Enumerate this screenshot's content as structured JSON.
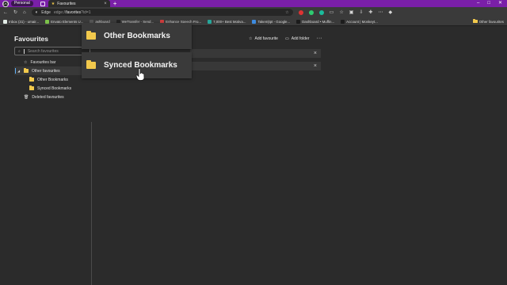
{
  "browser": {
    "profile_initials": "LK3",
    "profile_label": "Personal",
    "tab_title": "Favourites",
    "new_tab_glyph": "+",
    "url_prefix": "Edge",
    "url_host": "edge://",
    "url_path": "favorites",
    "url_suffix": "?id=1",
    "window_controls": [
      "–",
      "□",
      "✕"
    ],
    "accent_color": "#7a1fa8"
  },
  "bookmarks_bar": {
    "items": [
      {
        "label": "Inbox (31) - umair...",
        "color": "#e2ece6"
      },
      {
        "label": "Envato Elements U...",
        "color": "#7cc24a"
      },
      {
        "label": "ashboard",
        "color": "#555555"
      },
      {
        "label": "WeTransfer - Send...",
        "color": "#222222"
      },
      {
        "label": "Enhance Speech Fro...",
        "color": "#cc3d3d"
      },
      {
        "label": "7,000+ Best Motiva...",
        "color": "#26a69a"
      },
      {
        "label": "Takem|tpt - Google...",
        "color": "#3d8be0"
      },
      {
        "label": "Dashboard • Muffin...",
        "color": "#1b1b1b"
      },
      {
        "label": "Account | Monkeyt...",
        "color": "#1c1c1c"
      }
    ],
    "other_favourites": "Other favourites"
  },
  "sidebar": {
    "title": "Favourites",
    "search_placeholder": "Search favourites",
    "tree": [
      {
        "label": "Favourites bar",
        "icon": "star-icon",
        "depth": 0
      },
      {
        "label": "Other favourites",
        "icon": "folder-icon",
        "depth": 0,
        "expanded": true,
        "selected": true
      },
      {
        "label": "Other Bookmarks",
        "icon": "folder-icon",
        "depth": 1
      },
      {
        "label": "Synced Bookmarks",
        "icon": "folder-icon",
        "depth": 1
      },
      {
        "label": "Deleted favourites",
        "icon": "trash-icon",
        "depth": 0
      }
    ]
  },
  "main": {
    "add_favourite": "Add favourite",
    "add_folder": "Add folder",
    "more": "···"
  },
  "drag_overlay": {
    "items": [
      "Other Bookmarks",
      "Synced Bookmarks"
    ]
  }
}
